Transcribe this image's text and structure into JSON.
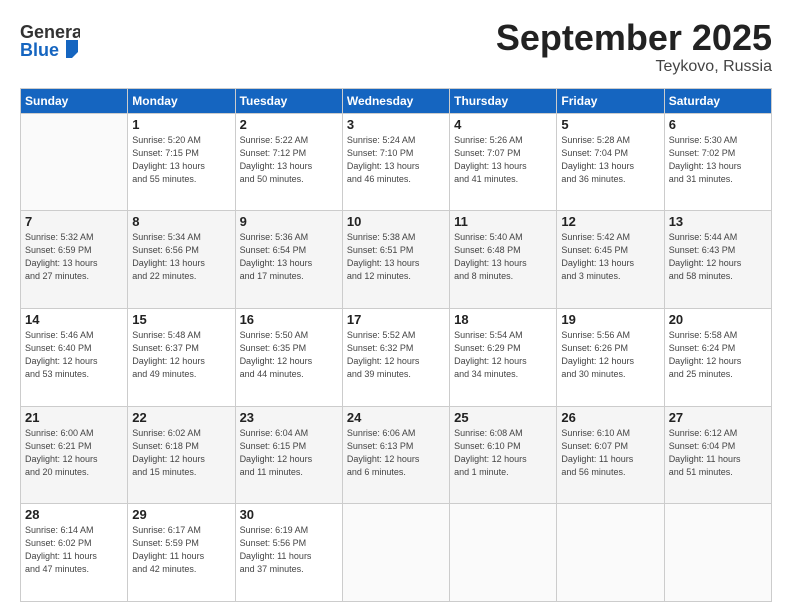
{
  "header": {
    "logo_general": "General",
    "logo_blue": "Blue",
    "month": "September 2025",
    "location": "Teykovo, Russia"
  },
  "days_of_week": [
    "Sunday",
    "Monday",
    "Tuesday",
    "Wednesday",
    "Thursday",
    "Friday",
    "Saturday"
  ],
  "weeks": [
    [
      {
        "day": "",
        "info": ""
      },
      {
        "day": "1",
        "info": "Sunrise: 5:20 AM\nSunset: 7:15 PM\nDaylight: 13 hours\nand 55 minutes."
      },
      {
        "day": "2",
        "info": "Sunrise: 5:22 AM\nSunset: 7:12 PM\nDaylight: 13 hours\nand 50 minutes."
      },
      {
        "day": "3",
        "info": "Sunrise: 5:24 AM\nSunset: 7:10 PM\nDaylight: 13 hours\nand 46 minutes."
      },
      {
        "day": "4",
        "info": "Sunrise: 5:26 AM\nSunset: 7:07 PM\nDaylight: 13 hours\nand 41 minutes."
      },
      {
        "day": "5",
        "info": "Sunrise: 5:28 AM\nSunset: 7:04 PM\nDaylight: 13 hours\nand 36 minutes."
      },
      {
        "day": "6",
        "info": "Sunrise: 5:30 AM\nSunset: 7:02 PM\nDaylight: 13 hours\nand 31 minutes."
      }
    ],
    [
      {
        "day": "7",
        "info": "Sunrise: 5:32 AM\nSunset: 6:59 PM\nDaylight: 13 hours\nand 27 minutes."
      },
      {
        "day": "8",
        "info": "Sunrise: 5:34 AM\nSunset: 6:56 PM\nDaylight: 13 hours\nand 22 minutes."
      },
      {
        "day": "9",
        "info": "Sunrise: 5:36 AM\nSunset: 6:54 PM\nDaylight: 13 hours\nand 17 minutes."
      },
      {
        "day": "10",
        "info": "Sunrise: 5:38 AM\nSunset: 6:51 PM\nDaylight: 13 hours\nand 12 minutes."
      },
      {
        "day": "11",
        "info": "Sunrise: 5:40 AM\nSunset: 6:48 PM\nDaylight: 13 hours\nand 8 minutes."
      },
      {
        "day": "12",
        "info": "Sunrise: 5:42 AM\nSunset: 6:45 PM\nDaylight: 13 hours\nand 3 minutes."
      },
      {
        "day": "13",
        "info": "Sunrise: 5:44 AM\nSunset: 6:43 PM\nDaylight: 12 hours\nand 58 minutes."
      }
    ],
    [
      {
        "day": "14",
        "info": "Sunrise: 5:46 AM\nSunset: 6:40 PM\nDaylight: 12 hours\nand 53 minutes."
      },
      {
        "day": "15",
        "info": "Sunrise: 5:48 AM\nSunset: 6:37 PM\nDaylight: 12 hours\nand 49 minutes."
      },
      {
        "day": "16",
        "info": "Sunrise: 5:50 AM\nSunset: 6:35 PM\nDaylight: 12 hours\nand 44 minutes."
      },
      {
        "day": "17",
        "info": "Sunrise: 5:52 AM\nSunset: 6:32 PM\nDaylight: 12 hours\nand 39 minutes."
      },
      {
        "day": "18",
        "info": "Sunrise: 5:54 AM\nSunset: 6:29 PM\nDaylight: 12 hours\nand 34 minutes."
      },
      {
        "day": "19",
        "info": "Sunrise: 5:56 AM\nSunset: 6:26 PM\nDaylight: 12 hours\nand 30 minutes."
      },
      {
        "day": "20",
        "info": "Sunrise: 5:58 AM\nSunset: 6:24 PM\nDaylight: 12 hours\nand 25 minutes."
      }
    ],
    [
      {
        "day": "21",
        "info": "Sunrise: 6:00 AM\nSunset: 6:21 PM\nDaylight: 12 hours\nand 20 minutes."
      },
      {
        "day": "22",
        "info": "Sunrise: 6:02 AM\nSunset: 6:18 PM\nDaylight: 12 hours\nand 15 minutes."
      },
      {
        "day": "23",
        "info": "Sunrise: 6:04 AM\nSunset: 6:15 PM\nDaylight: 12 hours\nand 11 minutes."
      },
      {
        "day": "24",
        "info": "Sunrise: 6:06 AM\nSunset: 6:13 PM\nDaylight: 12 hours\nand 6 minutes."
      },
      {
        "day": "25",
        "info": "Sunrise: 6:08 AM\nSunset: 6:10 PM\nDaylight: 12 hours\nand 1 minute."
      },
      {
        "day": "26",
        "info": "Sunrise: 6:10 AM\nSunset: 6:07 PM\nDaylight: 11 hours\nand 56 minutes."
      },
      {
        "day": "27",
        "info": "Sunrise: 6:12 AM\nSunset: 6:04 PM\nDaylight: 11 hours\nand 51 minutes."
      }
    ],
    [
      {
        "day": "28",
        "info": "Sunrise: 6:14 AM\nSunset: 6:02 PM\nDaylight: 11 hours\nand 47 minutes."
      },
      {
        "day": "29",
        "info": "Sunrise: 6:17 AM\nSunset: 5:59 PM\nDaylight: 11 hours\nand 42 minutes."
      },
      {
        "day": "30",
        "info": "Sunrise: 6:19 AM\nSunset: 5:56 PM\nDaylight: 11 hours\nand 37 minutes."
      },
      {
        "day": "",
        "info": ""
      },
      {
        "day": "",
        "info": ""
      },
      {
        "day": "",
        "info": ""
      },
      {
        "day": "",
        "info": ""
      }
    ]
  ]
}
